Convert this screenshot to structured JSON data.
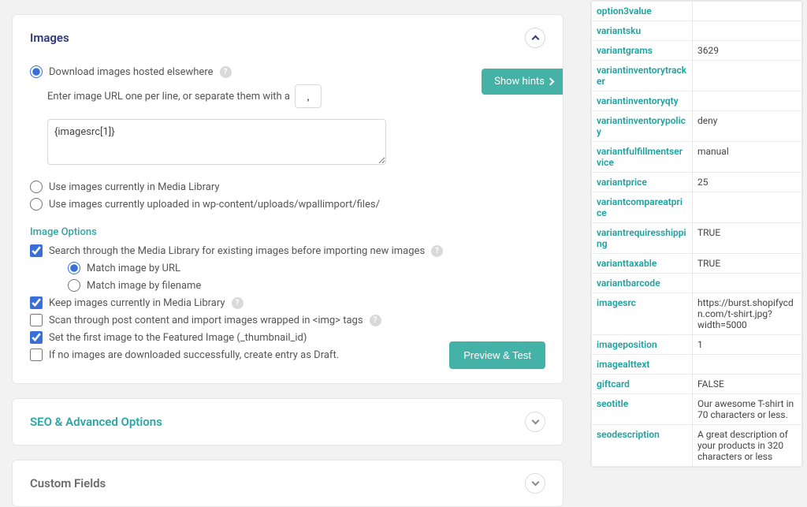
{
  "images_panel": {
    "title": "Images",
    "radio_download": "Download images hosted elsewhere",
    "enter_url_label_pre": "Enter image URL one per line, or separate them with a",
    "separator_value": ",",
    "textarea_value": "{imagesrc[1]}",
    "radio_media_library": "Use images currently in Media Library",
    "radio_uploads": "Use images currently uploaded in wp-content/uploads/wpallimport/files/",
    "show_hints": "Show hints",
    "options_title": "Image Options",
    "chk_search_media": "Search through the Media Library for existing images before importing new images",
    "radio_match_url": "Match image by URL",
    "radio_match_filename": "Match image by filename",
    "chk_keep_media": "Keep images currently in Media Library",
    "chk_scan_post": "Scan through post content and import images wrapped in <img> tags",
    "chk_set_featured": "Set the first image to the Featured Image (_thumbnail_id)",
    "chk_draft": "If no images are downloaded successfully, create entry as Draft.",
    "preview_btn": "Preview & Test"
  },
  "seo_panel": {
    "title": "SEO & Advanced Options"
  },
  "custom_panel": {
    "title": "Custom Fields"
  },
  "side_rows": [
    {
      "k": "option3value",
      "v": ""
    },
    {
      "k": "variantsku",
      "v": ""
    },
    {
      "k": "variantgrams",
      "v": "3629"
    },
    {
      "k": "variantinventorytracker",
      "v": ""
    },
    {
      "k": "variantinventoryqty",
      "v": ""
    },
    {
      "k": "variantinventorypolicy",
      "v": "deny"
    },
    {
      "k": "variantfulfillmentservice",
      "v": "manual"
    },
    {
      "k": "variantprice",
      "v": "25"
    },
    {
      "k": "variantcompareatprice",
      "v": ""
    },
    {
      "k": "variantrequiresshipping",
      "v": "TRUE"
    },
    {
      "k": "varianttaxable",
      "v": "TRUE"
    },
    {
      "k": "variantbarcode",
      "v": ""
    },
    {
      "k": "imagesrc",
      "v": "https://burst.shopifycdn.com/t-shirt.jpg?width=5000"
    },
    {
      "k": "imageposition",
      "v": "1"
    },
    {
      "k": "imagealttext",
      "v": ""
    },
    {
      "k": "giftcard",
      "v": "FALSE"
    },
    {
      "k": "seotitle",
      "v": "Our awesome T-shirt in 70 characters or less."
    },
    {
      "k": "seodescription",
      "v": "A great description of your products in 320 characters or less"
    }
  ]
}
